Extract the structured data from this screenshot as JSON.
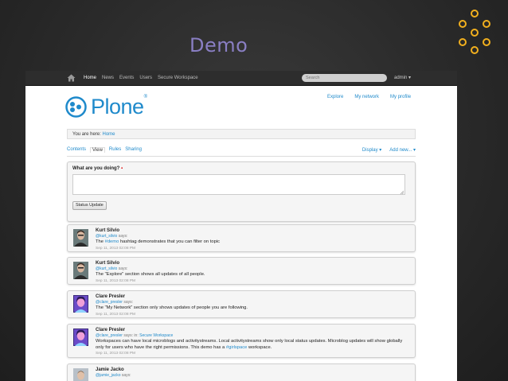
{
  "slide": {
    "title": "Demo",
    "accent_color": "#f2b01e",
    "title_color": "#8a7fc4"
  },
  "topbar": {
    "home_icon": "home-icon",
    "nav": [
      "Home",
      "News",
      "Events",
      "Users",
      "Secure Workspace"
    ],
    "search_placeholder": "Search",
    "user": "admin"
  },
  "site": {
    "logo_text": "Plone",
    "logo_mark": "®",
    "brand_color": "#1f8acb"
  },
  "user_links": [
    "Explore",
    "My network",
    "My profile"
  ],
  "breadcrumb": {
    "prefix": "You are here:",
    "home": "Home"
  },
  "content_tabs": [
    "Contents",
    "View",
    "Rules",
    "Sharing"
  ],
  "content_actions": [
    "Display",
    "Add new..."
  ],
  "status_form": {
    "question": "What are you doing?",
    "required_marker": "▪",
    "value": "",
    "button_label": "Status Update"
  },
  "posts": [
    {
      "name": "Kurt Silvio",
      "handle": "@kurt_silvio",
      "says": "says:",
      "context_prefix": "",
      "context": "",
      "text_before": "The ",
      "tag": "#demo",
      "text_after": " hashtag demonstrates that you can filter on topic",
      "time": "Sep 11, 2013 02:08 PM"
    },
    {
      "name": "Kurt Silvio",
      "handle": "@kurt_silvio",
      "says": "says:",
      "context_prefix": "",
      "context": "",
      "text_before": "The \"Explore\" section shows all updates of all people.",
      "tag": "",
      "text_after": "",
      "time": "Sep 11, 2013 02:08 PM"
    },
    {
      "name": "Clare Presler",
      "handle": "@clare_presler",
      "says": "says:",
      "context_prefix": "",
      "context": "",
      "text_before": "The \"My Network\" section only shows updates of people you are following.",
      "tag": "",
      "text_after": "",
      "time": "Sep 11, 2013 02:08 PM"
    },
    {
      "name": "Clare Presler",
      "handle": "@clare_presler",
      "says": "says:",
      "context_prefix": " in: ",
      "context": "Secure Workspace",
      "text_before": "Workspaces can have local microblogs and activitystreams. Local activitystreams show only local status updates. Microblog updates will show globally only for users who have the right permissions. This demo has a ",
      "tag": "#girlspace",
      "text_after": " workspace.",
      "time": "Sep 11, 2013 02:08 PM"
    },
    {
      "name": "Jamie Jacko",
      "handle": "@jamie_jacko",
      "says": "says:",
      "context_prefix": "",
      "context": "",
      "text_before": "",
      "tag": "",
      "text_after": "",
      "time": ""
    }
  ]
}
